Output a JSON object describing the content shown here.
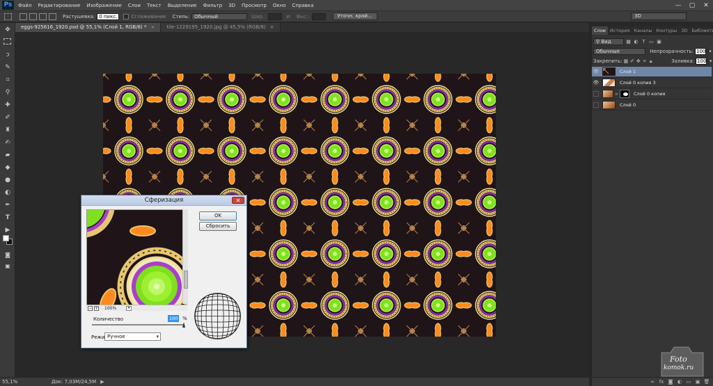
{
  "app": {
    "logo": "Ps"
  },
  "menu": [
    "Файл",
    "Редактирование",
    "Изображение",
    "Слои",
    "Текст",
    "Выделение",
    "Фильтр",
    "3D",
    "Просмотр",
    "Окно",
    "Справка"
  ],
  "window_controls": {
    "minimize": "—",
    "maximize": "▢",
    "close": "✕"
  },
  "options_bar": {
    "feather_label": "Растушевка:",
    "feather_value": "0 пикс.",
    "antialias_label": "Сглаживание",
    "style_label": "Стиль:",
    "style_value": "Обычный",
    "width_label": "Шир.:",
    "height_label": "Выс.:",
    "refine_edge_label": "Уточн. край...",
    "workspace_value": "3D"
  },
  "tabs": [
    {
      "label": "eggs-925616_1920.psd @ 55,1% (Слой 1, RGB/8) *",
      "close": "×",
      "active": true
    },
    {
      "label": "tile-1229195_1920.jpg @ 45,5% (RGB/8)",
      "close": "×",
      "active": false
    }
  ],
  "status_bar": {
    "zoom": "55,1%",
    "doc_info": "Док: 7,03M/24,5M",
    "arrow": "▶"
  },
  "layers_panel": {
    "tabs": [
      "Слои",
      "История",
      "Каналы",
      "Контуры",
      "3D",
      "Библиотеки"
    ],
    "filter_value": "Вид",
    "blend_mode": "Обычные",
    "opacity_label": "Непрозрачность:",
    "opacity_value": "100%",
    "lock_label": "Закрепить:",
    "fill_label": "Заливка:",
    "fill_value": "100%",
    "layers": [
      {
        "name": "Слой 1",
        "visible": true,
        "selected": true,
        "mask": false
      },
      {
        "name": "Слой 0 копия 3",
        "visible": true,
        "selected": false,
        "mask": false
      },
      {
        "name": "Слой 0 копия",
        "visible": false,
        "selected": false,
        "mask": true
      },
      {
        "name": "Слой 0",
        "visible": false,
        "selected": false,
        "mask": false
      }
    ]
  },
  "watermark": {
    "line1": "Foto",
    "line2": "komok.ru"
  },
  "dialog": {
    "title": "Сферизация",
    "close": "✕",
    "ok_label": "OK",
    "reset_label": "Сбросить",
    "zoom_minus": "−",
    "zoom_plus": "+",
    "preview_zoom": "100%",
    "amount_label": "Количество",
    "amount_value": "100",
    "amount_unit": "%",
    "amount_slider_fraction": 1.0,
    "mode_label": "Режим",
    "mode_value": "Ручное"
  },
  "colors": {
    "pattern_background": "#1f1418",
    "pattern_gold": "#e6c770",
    "pattern_green": "#7fe020",
    "pattern_orange": "#ff8a1c",
    "pattern_purple": "#a93fc9",
    "selected_layer": "#6f86a6",
    "dialog_close": "#c9463d"
  }
}
